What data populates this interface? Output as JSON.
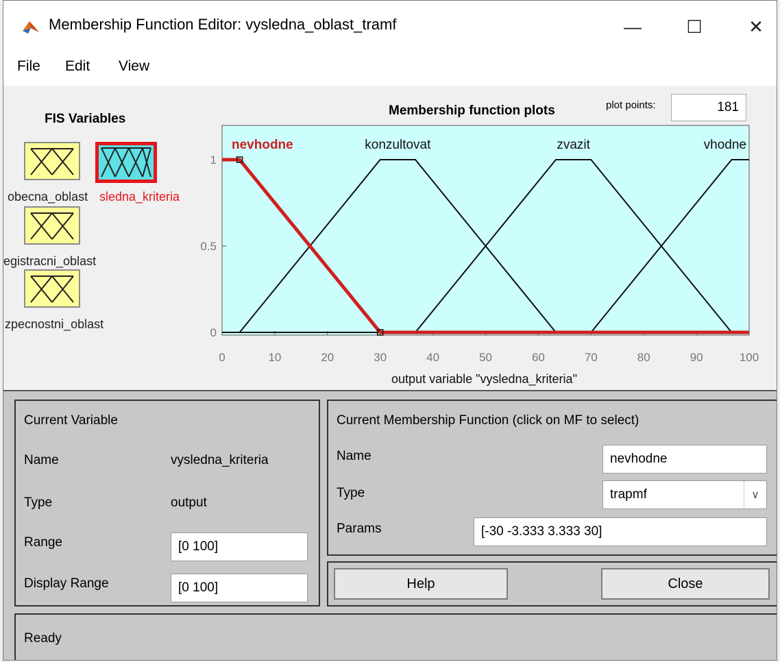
{
  "window": {
    "title": "Membership Function Editor: vysledna_oblast_tramf",
    "minimize_glyph": "—",
    "maximize_glyph": "☐",
    "close_glyph": "✕",
    "app_icon": "matlab-logo-icon"
  },
  "menu": [
    {
      "label": "File"
    },
    {
      "label": "Edit"
    },
    {
      "label": "View"
    }
  ],
  "fis": {
    "title": "FIS Variables",
    "variables": [
      {
        "label": "obecna_oblast",
        "visible_text": "obecna_oblast",
        "kind": "input",
        "selected": false
      },
      {
        "label": "vysledna_kriteria",
        "visible_text": "sledna_kriteria",
        "kind": "output",
        "selected": true
      },
      {
        "label": "registracni_oblast",
        "visible_text": "egistracni_oblast",
        "kind": "input",
        "selected": false
      },
      {
        "label": "bezpecnostni_oblast",
        "visible_text": "zpecnostni_oblast",
        "kind": "input",
        "selected": false
      }
    ]
  },
  "plot": {
    "title": "Membership function plots",
    "plot_points_label": "plot points:",
    "plot_points_value": "181"
  },
  "chart_data": {
    "type": "line",
    "xlabel": "output variable \"vysledna_kriteria\"",
    "xlim": [
      0,
      100
    ],
    "ylim": [
      0,
      1
    ],
    "xticks": [
      "0",
      "10",
      "20",
      "30",
      "40",
      "50",
      "60",
      "70",
      "80",
      "90",
      "100"
    ],
    "yticks": [
      "0",
      "0.5",
      "1"
    ],
    "grid": false,
    "background": "#ccfefe",
    "selected_color": "#d0201e",
    "line_color": "#111111",
    "series": [
      {
        "name": "nevhodne",
        "params": [
          -30,
          -3.333,
          3.333,
          30
        ],
        "selected": true
      },
      {
        "name": "konzultovat",
        "params": [
          3.333,
          30,
          36.67,
          63.33
        ],
        "selected": false
      },
      {
        "name": "zvazit",
        "params": [
          36.67,
          63.33,
          70,
          96.67
        ],
        "selected": false
      },
      {
        "name": "vhodne",
        "params": [
          70,
          96.67,
          103.3,
          130
        ],
        "selected": false
      }
    ]
  },
  "current_variable": {
    "title": "Current Variable",
    "name_label": "Name",
    "name_value": "vysledna_kriteria",
    "type_label": "Type",
    "type_value": "output",
    "range_label": "Range",
    "range_value": "[0 100]",
    "display_range_label": "Display Range",
    "display_range_value": "[0 100]"
  },
  "current_mf": {
    "title": "Current Membership Function (click on MF to select)",
    "name_label": "Name",
    "name_value": "nevhodne",
    "type_label": "Type",
    "type_value": "trapmf",
    "params_label": "Params",
    "params_value": "[-30 -3.333 3.333 30]"
  },
  "buttons": {
    "help": "Help",
    "close": "Close"
  },
  "status": "Ready"
}
